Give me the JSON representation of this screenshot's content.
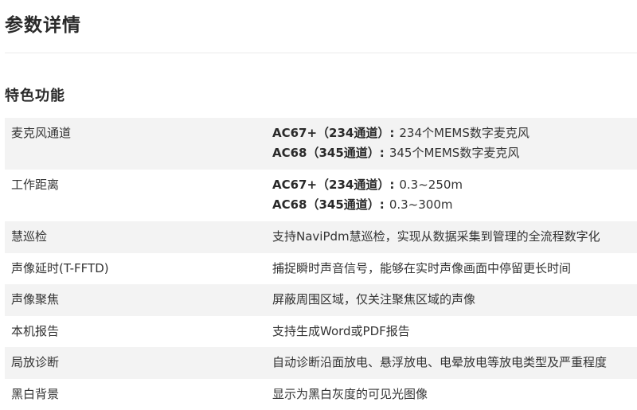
{
  "page_title": "参数详情",
  "section_title": "特色功能",
  "rows": [
    {
      "label": "麦克风通道",
      "lines": [
        {
          "model": "AC67+（234通道）:",
          "text": "234个MEMS数字麦克风"
        },
        {
          "model": "AC68（345通道）:",
          "text": "345个MEMS数字麦克风"
        }
      ]
    },
    {
      "label": "工作距离",
      "lines": [
        {
          "model": "AC67+（234通道）:",
          "text": "0.3~250m"
        },
        {
          "model": "AC68（345通道）:",
          "text": "0.3~300m"
        }
      ]
    },
    {
      "label": "慧巡检",
      "value": "支持NaviPdm慧巡检，实现从数据采集到管理的全流程数字化"
    },
    {
      "label": "声像延时(T-FFTD)",
      "value": "捕捉瞬时声音信号，能够在实时声像画面中停留更长时间"
    },
    {
      "label": "声像聚焦",
      "value": "屏蔽周围区域，仅关注聚焦区域的声像"
    },
    {
      "label": "本机报告",
      "value": "支持生成Word或PDF报告"
    },
    {
      "label": "局放诊断",
      "value": "自动诊断沿面放电、悬浮放电、电晕放电等放电类型及严重程度"
    },
    {
      "label": "黑白背景",
      "value": "显示为黑白灰度的可见光图像"
    }
  ]
}
